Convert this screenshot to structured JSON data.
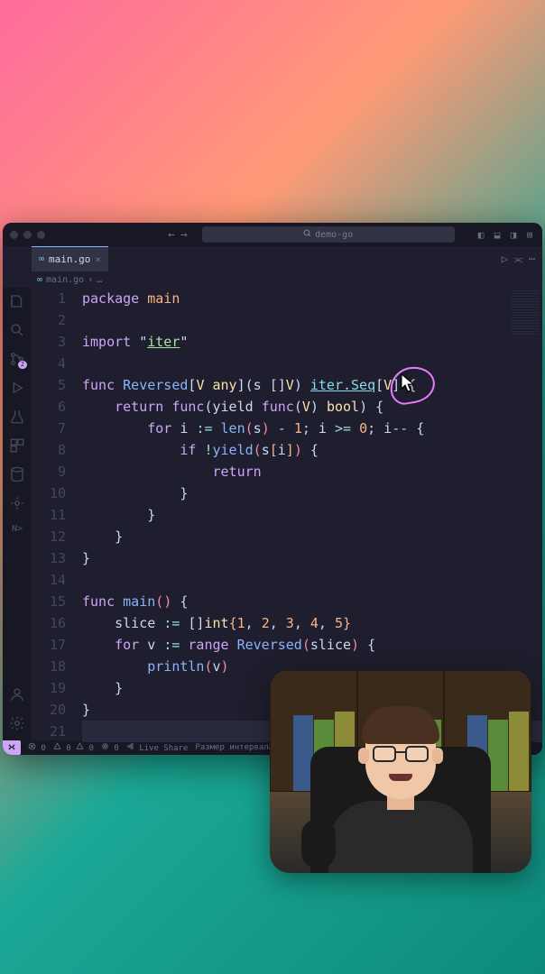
{
  "window": {
    "project": "demo-go"
  },
  "tab": {
    "filename": "main.go"
  },
  "breadcrumb": {
    "file": "main.go",
    "sep": "›",
    "dots": "…"
  },
  "activity": {
    "scm_badge": "2"
  },
  "code": {
    "lines": [
      {
        "n": 1,
        "tokens": [
          [
            "kw",
            "package"
          ],
          [
            "",
            " "
          ],
          [
            "pkg",
            "main"
          ]
        ]
      },
      {
        "n": 2,
        "tokens": []
      },
      {
        "n": 3,
        "tokens": [
          [
            "kw",
            "import"
          ],
          [
            "",
            " \""
          ],
          [
            "str",
            "iter"
          ],
          [
            "",
            "\""
          ]
        ]
      },
      {
        "n": 4,
        "tokens": []
      },
      {
        "n": 5,
        "tokens": [
          [
            "kw",
            "func"
          ],
          [
            "",
            " "
          ],
          [
            "fn",
            "Reversed"
          ],
          [
            "",
            "["
          ],
          [
            "type",
            "V"
          ],
          [
            "",
            " "
          ],
          [
            "type",
            "any"
          ],
          [
            "",
            "]("
          ],
          [
            "",
            "s []"
          ],
          [
            "type",
            "V"
          ],
          [
            "",
            ") "
          ],
          [
            "ident-iter",
            "iter.Seq"
          ],
          [
            "",
            "["
          ],
          [
            "type",
            "V"
          ],
          [
            "",
            "] {"
          ]
        ]
      },
      {
        "n": 6,
        "tokens": [
          [
            "",
            "    "
          ],
          [
            "kw",
            "return"
          ],
          [
            "",
            " "
          ],
          [
            "kw",
            "func"
          ],
          [
            "",
            "("
          ],
          [
            "",
            "yield "
          ],
          [
            "kw",
            "func"
          ],
          [
            "",
            "("
          ],
          [
            "type",
            "V"
          ],
          [
            "",
            ") "
          ],
          [
            "type",
            "bool"
          ],
          [
            "",
            ") {"
          ]
        ]
      },
      {
        "n": 7,
        "tokens": [
          [
            "",
            "        "
          ],
          [
            "kw",
            "for"
          ],
          [
            "",
            " i "
          ],
          [
            "op",
            ":="
          ],
          [
            "",
            " "
          ],
          [
            "fn",
            "len"
          ],
          [
            "paren",
            "("
          ],
          [
            "",
            "s"
          ],
          [
            "paren",
            ")"
          ],
          [
            "",
            " "
          ],
          [
            "op",
            "-"
          ],
          [
            "",
            " "
          ],
          [
            "num",
            "1"
          ],
          [
            "",
            "; i "
          ],
          [
            "op",
            ">="
          ],
          [
            "",
            " "
          ],
          [
            "num",
            "0"
          ],
          [
            "",
            "; i"
          ],
          [
            "op",
            "--"
          ],
          [
            "",
            " {"
          ]
        ]
      },
      {
        "n": 8,
        "tokens": [
          [
            "",
            "            "
          ],
          [
            "kw",
            "if"
          ],
          [
            "",
            " "
          ],
          [
            "op",
            "!"
          ],
          [
            "fn",
            "yield"
          ],
          [
            "paren",
            "("
          ],
          [
            "",
            "s"
          ],
          [
            "bracket1",
            "["
          ],
          [
            "",
            "i"
          ],
          [
            "bracket1",
            "]"
          ],
          [
            "paren",
            ")"
          ],
          [
            "",
            " {"
          ]
        ]
      },
      {
        "n": 9,
        "tokens": [
          [
            "",
            "                "
          ],
          [
            "kw",
            "return"
          ]
        ]
      },
      {
        "n": 10,
        "tokens": [
          [
            "",
            "            }"
          ]
        ]
      },
      {
        "n": 11,
        "tokens": [
          [
            "",
            "        }"
          ]
        ]
      },
      {
        "n": 12,
        "tokens": [
          [
            "",
            "    }"
          ]
        ]
      },
      {
        "n": 13,
        "tokens": [
          [
            "",
            "}"
          ]
        ]
      },
      {
        "n": 14,
        "tokens": []
      },
      {
        "n": 15,
        "tokens": [
          [
            "kw",
            "func"
          ],
          [
            "",
            " "
          ],
          [
            "fn",
            "main"
          ],
          [
            "paren",
            "("
          ],
          [
            "paren",
            ")"
          ],
          [
            "",
            " {"
          ]
        ]
      },
      {
        "n": 16,
        "tokens": [
          [
            "",
            "    slice "
          ],
          [
            "op",
            ":="
          ],
          [
            "",
            " []"
          ],
          [
            "type",
            "int"
          ],
          [
            "bracket1",
            "{"
          ],
          [
            "num",
            "1"
          ],
          [
            "",
            ", "
          ],
          [
            "num",
            "2"
          ],
          [
            "",
            ", "
          ],
          [
            "num",
            "3"
          ],
          [
            "",
            ", "
          ],
          [
            "num",
            "4"
          ],
          [
            "",
            ", "
          ],
          [
            "num",
            "5"
          ],
          [
            "bracket1",
            "}"
          ]
        ]
      },
      {
        "n": 17,
        "tokens": [
          [
            "",
            "    "
          ],
          [
            "kw",
            "for"
          ],
          [
            "",
            " v "
          ],
          [
            "op",
            ":="
          ],
          [
            "",
            " "
          ],
          [
            "kw",
            "range"
          ],
          [
            "",
            " "
          ],
          [
            "fn",
            "Reversed"
          ],
          [
            "paren",
            "("
          ],
          [
            "",
            "slice"
          ],
          [
            "paren",
            ")"
          ],
          [
            "",
            " {"
          ]
        ]
      },
      {
        "n": 18,
        "tokens": [
          [
            "",
            "        "
          ],
          [
            "fn",
            "println"
          ],
          [
            "paren",
            "("
          ],
          [
            "",
            "v"
          ],
          [
            "paren",
            ")"
          ]
        ]
      },
      {
        "n": 19,
        "tokens": [
          [
            "",
            "    }"
          ]
        ]
      },
      {
        "n": 20,
        "tokens": [
          [
            "",
            "}"
          ]
        ]
      },
      {
        "n": 21,
        "tokens": [],
        "highlight": true
      }
    ]
  },
  "statusbar": {
    "errors": "0",
    "warnings": "0",
    "triangle": "0",
    "ports": "0",
    "liveshare": "Live Share",
    "spacing": "Размер интервала таб"
  }
}
